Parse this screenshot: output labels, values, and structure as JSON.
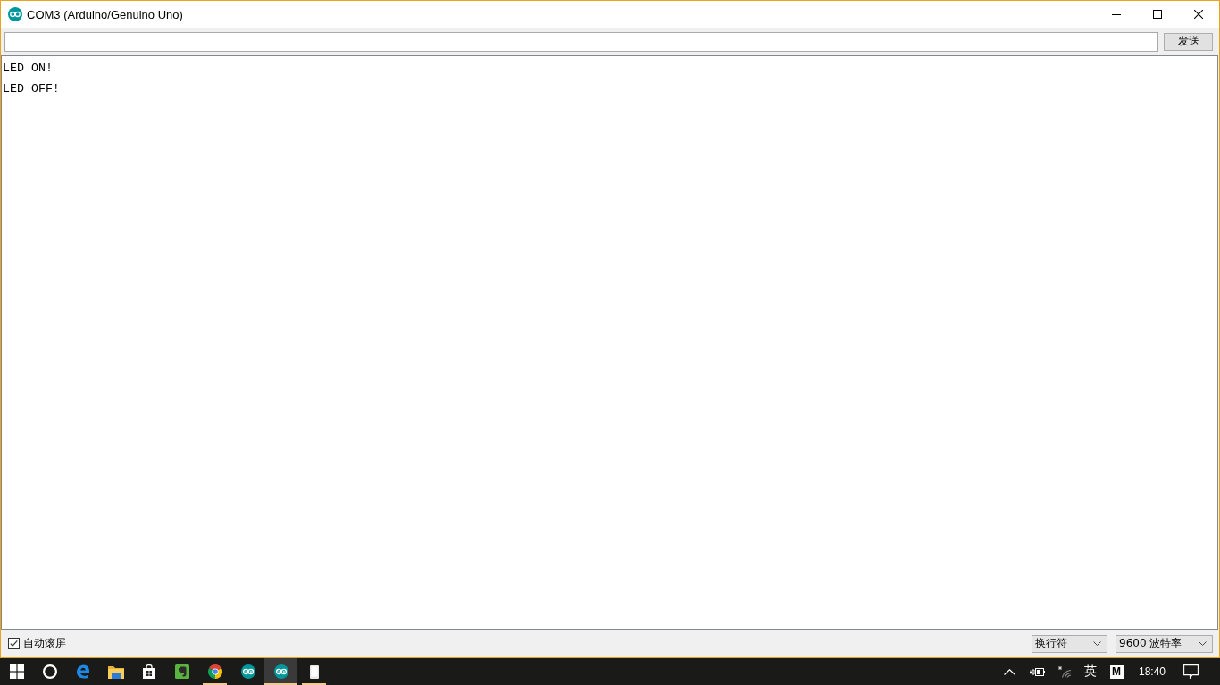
{
  "window": {
    "title": "COM3 (Arduino/Genuino Uno)"
  },
  "send_bar": {
    "button": "发送"
  },
  "output": {
    "lines": [
      "LED ON!",
      "LED OFF!"
    ]
  },
  "footer": {
    "autoscroll": {
      "label": "自动滚屏",
      "checked": true
    },
    "line_ending": "换行符",
    "baud_rate": "9600 波特率"
  },
  "taskbar": {
    "items": [
      {
        "kind": "start",
        "running": false,
        "selected": false
      },
      {
        "kind": "search",
        "running": false,
        "selected": false
      },
      {
        "kind": "edge",
        "running": false,
        "selected": false
      },
      {
        "kind": "folder",
        "running": false,
        "selected": false
      },
      {
        "kind": "store",
        "running": false,
        "selected": false
      },
      {
        "kind": "notes",
        "running": false,
        "selected": false
      },
      {
        "kind": "chrome",
        "running": true,
        "selected": false
      },
      {
        "kind": "arduino",
        "running": false,
        "selected": false
      },
      {
        "kind": "arduino",
        "running": true,
        "selected": true
      },
      {
        "kind": "tablet",
        "running": true,
        "selected": false
      }
    ]
  },
  "tray": {
    "language": "英",
    "ime_mode": "M",
    "clock": "18:40"
  }
}
